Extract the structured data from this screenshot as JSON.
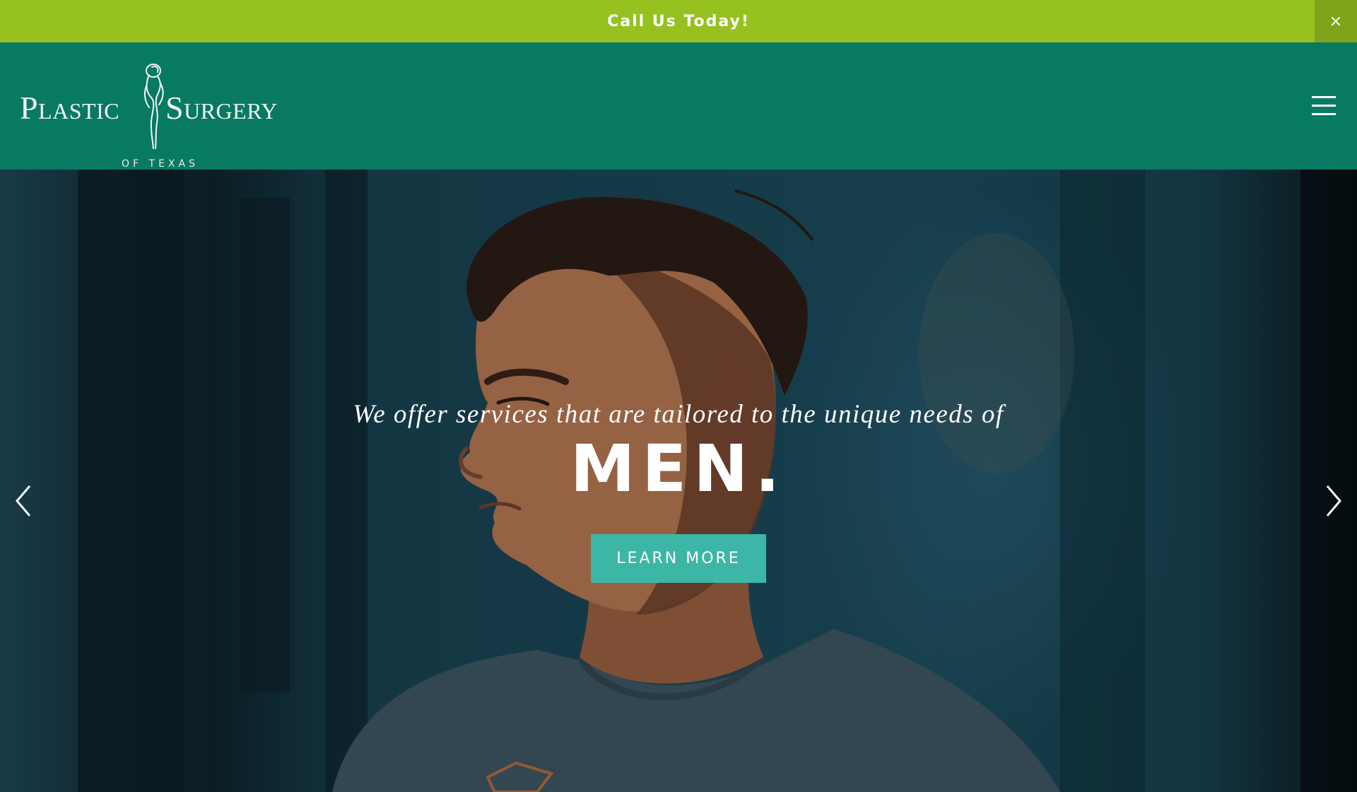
{
  "announcement": {
    "text": "Call Us Today!",
    "close_icon": "close-icon",
    "close_glyph": "×"
  },
  "header": {
    "logo": {
      "word_left": "Plastic",
      "word_right": "Surgery",
      "subline": "OF TEXAS",
      "emblem_icon": "female-silhouette-icon"
    },
    "menu_icon": "hamburger-menu-icon"
  },
  "hero": {
    "tagline": "We offer services that are tailored to the unique needs of",
    "title": "MEN.",
    "cta_label": "LEARN MORE",
    "prev_icon": "chevron-left-icon",
    "next_icon": "chevron-right-icon"
  },
  "colors": {
    "announcement_bg": "#96c11f",
    "header_bg": "#077a61",
    "cta_bg": "#3cb6a6"
  }
}
